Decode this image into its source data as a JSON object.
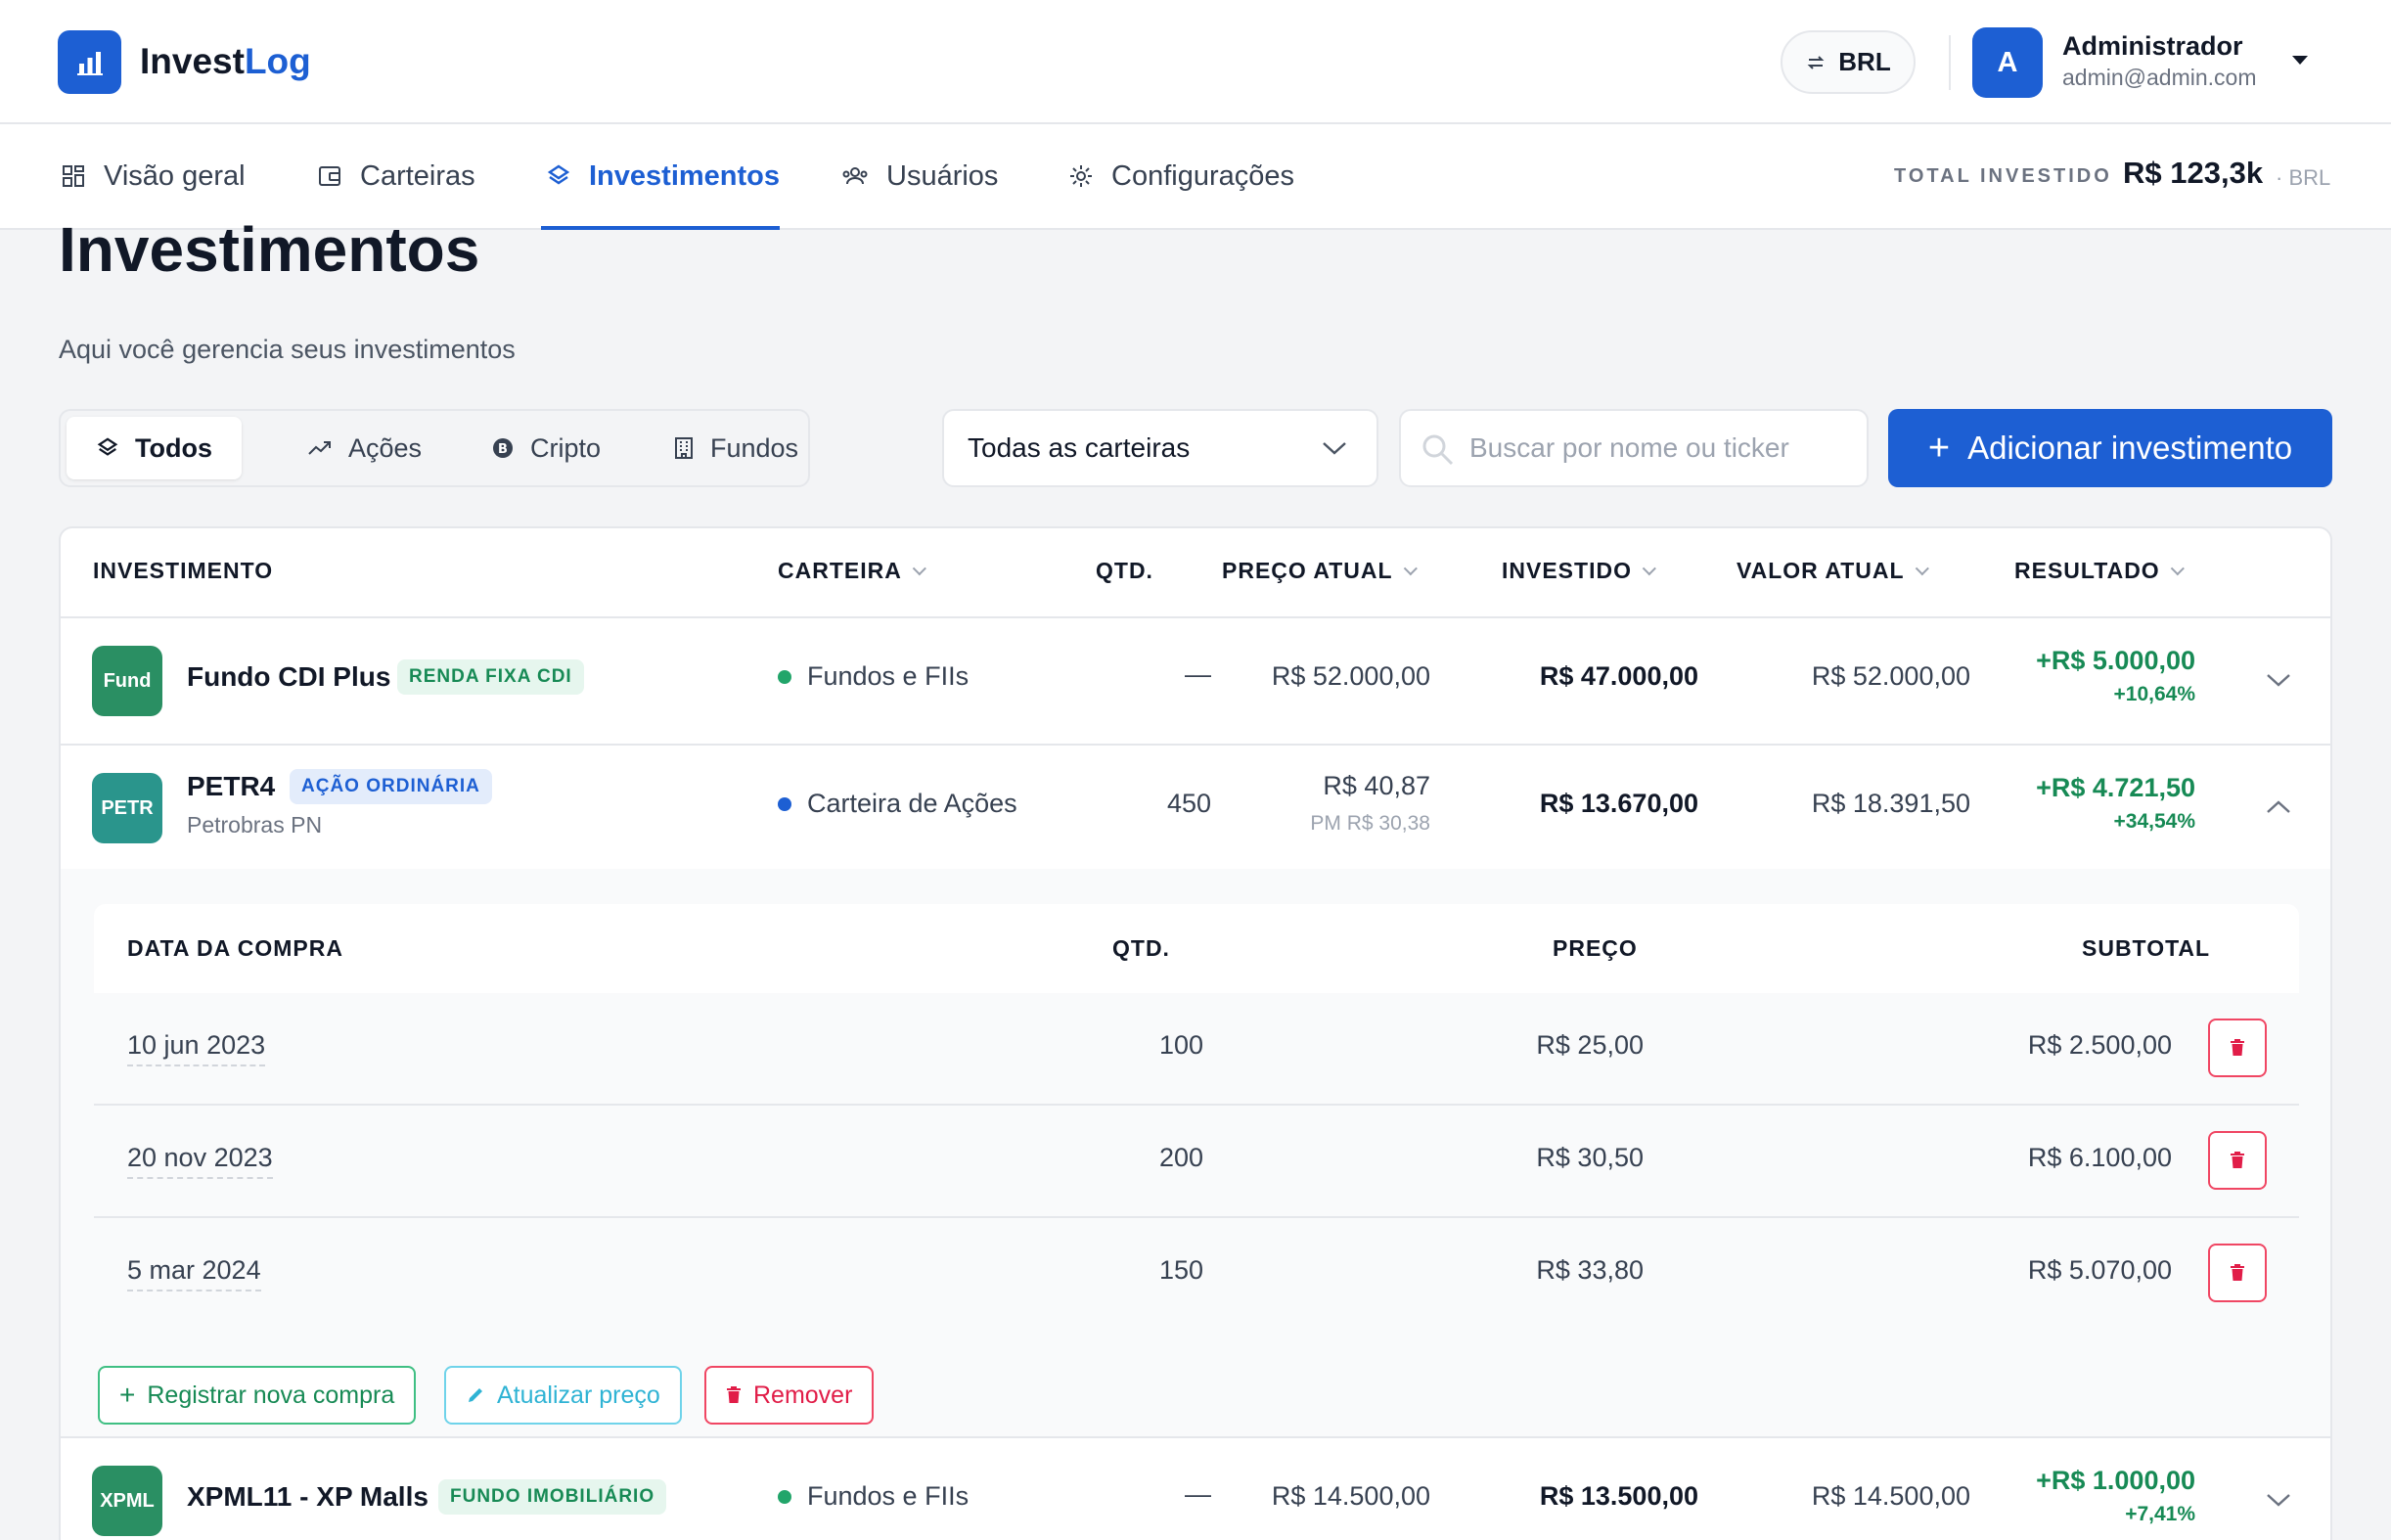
{
  "app": {
    "name_part1": "Invest",
    "name_part2": "Log"
  },
  "header": {
    "currency": "BRL",
    "user": {
      "initial": "A",
      "name": "Administrador",
      "email": "admin@admin.com"
    }
  },
  "nav": {
    "items": [
      {
        "label": "Visão geral",
        "icon": "grid-icon"
      },
      {
        "label": "Carteiras",
        "icon": "wallet-icon"
      },
      {
        "label": "Investimentos",
        "icon": "layers-icon",
        "active": true
      },
      {
        "label": "Usuários",
        "icon": "users-icon"
      },
      {
        "label": "Configurações",
        "icon": "gear-icon"
      }
    ],
    "total_label": "TOTAL INVESTIDO",
    "total_value": "R$ 123,3k",
    "total_currency": "· BRL"
  },
  "page": {
    "title": "Investimentos",
    "subtitle": "Aqui você gerencia seus investimentos"
  },
  "filters": {
    "tabs": [
      {
        "label": "Todos",
        "icon": "layers-icon",
        "active": true
      },
      {
        "label": "Ações",
        "icon": "trend-icon"
      },
      {
        "label": "Cripto",
        "icon": "bitcoin-icon"
      },
      {
        "label": "Fundos",
        "icon": "building-icon"
      }
    ],
    "wallet_select": "Todas as carteiras",
    "search_placeholder": "Buscar por nome ou ticker",
    "add_button": "Adicionar investimento"
  },
  "table": {
    "columns": {
      "investment": "INVESTIMENTO",
      "wallet": "CARTEIRA",
      "qty": "QTD.",
      "price": "PREÇO ATUAL",
      "invested": "INVESTIDO",
      "current": "VALOR ATUAL",
      "result": "RESULTADO"
    },
    "rows": [
      {
        "badge": "Fund",
        "badge_color": "#2a8f63",
        "name": "Fundo CDI Plus",
        "tag": "RENDA FIXA CDI",
        "wallet": "Fundos e FIIs",
        "wallet_color": "#22a56a",
        "qty": "—",
        "price": "R$ 52.000,00",
        "invested": "R$ 47.000,00",
        "current": "R$ 52.000,00",
        "result": "+R$ 5.000,00",
        "result_pct": "+10,64%"
      },
      {
        "badge": "PETR",
        "badge_color": "#2a958c",
        "name": "PETR4",
        "tag": "AÇÃO ORDINÁRIA",
        "subname": "Petrobras PN",
        "wallet": "Carteira de Ações",
        "wallet_color": "#1d5fd3",
        "qty": "450",
        "price": "R$ 40,87",
        "price_sub": "PM R$ 30,38",
        "invested": "R$ 13.670,00",
        "current": "R$ 18.391,50",
        "result": "+R$ 4.721,50",
        "result_pct": "+34,54%"
      },
      {
        "badge": "XPML",
        "badge_color": "#2a8f63",
        "name": "XPML11 - XP Malls",
        "tag": "FUNDO IMOBILIÁRIO",
        "wallet": "Fundos e FIIs",
        "wallet_color": "#22a56a",
        "qty": "—",
        "price": "R$ 14.500,00",
        "invested": "R$ 13.500,00",
        "current": "R$ 14.500,00",
        "result": "+R$ 1.000,00",
        "result_pct": "+7,41%"
      }
    ],
    "purchases": {
      "columns": {
        "date": "DATA DA COMPRA",
        "qty": "QTD.",
        "price": "PREÇO",
        "subtotal": "SUBTOTAL"
      },
      "rows": [
        {
          "date": "10 jun 2023",
          "qty": "100",
          "price": "R$ 25,00",
          "subtotal": "R$ 2.500,00"
        },
        {
          "date": "20 nov 2023",
          "qty": "200",
          "price": "R$ 30,50",
          "subtotal": "R$ 6.100,00"
        },
        {
          "date": "5 mar 2024",
          "qty": "150",
          "price": "R$ 33,80",
          "subtotal": "R$ 5.070,00"
        }
      ],
      "actions": {
        "register": "Registrar nova compra",
        "update": "Atualizar preço",
        "remove": "Remover"
      }
    }
  }
}
